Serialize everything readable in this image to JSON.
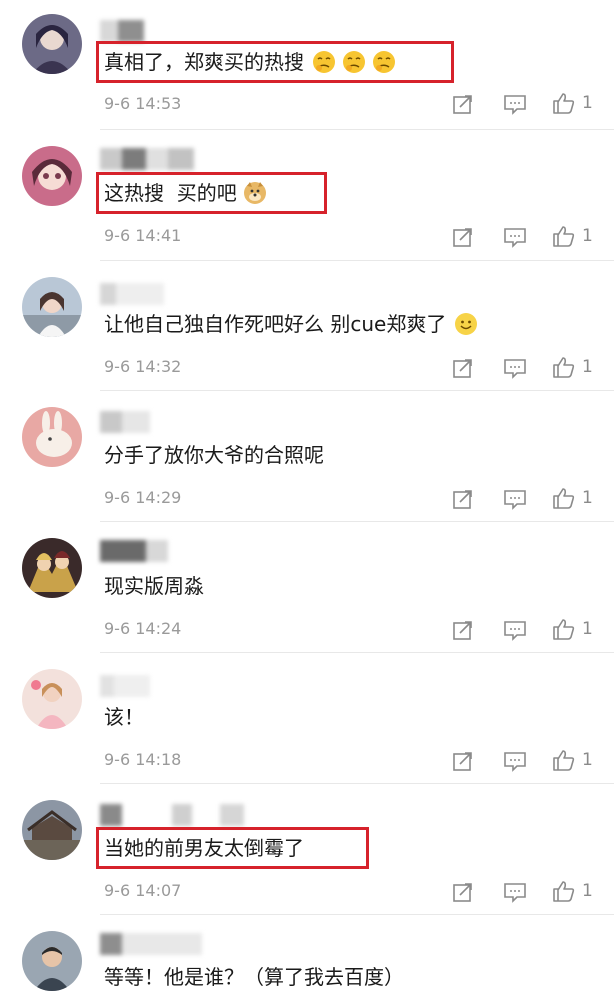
{
  "comments": [
    {
      "text": "真相了，郑爽买的热搜",
      "time": "9-6 14:53",
      "likes": "1",
      "highlighted": true,
      "emoji": "hmm-face-icon x3"
    },
    {
      "text": "这热搜  买的吧",
      "time": "9-6 14:41",
      "likes": "1",
      "highlighted": true,
      "emoji": "doge-icon"
    },
    {
      "text": "让他自己独自作死吧好么 别cue郑爽了",
      "time": "9-6 14:32",
      "likes": "1",
      "highlighted": false,
      "emoji": "smile-face-icon"
    },
    {
      "text": "分手了放你大爷的合照呢",
      "time": "9-6 14:29",
      "likes": "1",
      "highlighted": false
    },
    {
      "text": "现实版周淼",
      "time": "9-6 14:24",
      "likes": "1",
      "highlighted": false
    },
    {
      "text": "该！",
      "time": "9-6 14:18",
      "likes": "1",
      "highlighted": false
    },
    {
      "text": "当她的前男友太倒霉了",
      "time": "9-6 14:07",
      "likes": "1",
      "highlighted": true
    },
    {
      "text": "等等！他是谁？（算了我去百度）",
      "time": "",
      "likes": "",
      "highlighted": false
    }
  ],
  "colors": {
    "highlight_border": "#d6222b",
    "timestamp": "#9a9a9a",
    "icon": "#8a8a8a"
  }
}
